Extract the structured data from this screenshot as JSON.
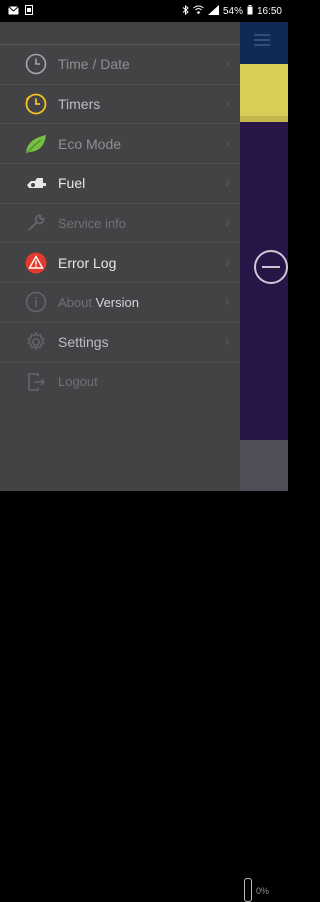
{
  "status_bar": {
    "left_icons": [
      "mail-icon",
      "sim-icon"
    ],
    "right_icons": [
      "bluetooth-icon",
      "wifi-icon",
      "signal-icon"
    ],
    "battery": "54%",
    "time": "16:50"
  },
  "background": {
    "gauge_pct": "0%"
  },
  "menu": [
    {
      "label": "Time / Date",
      "icon": "clock-icon",
      "has_chevron": true
    },
    {
      "label": "Timers",
      "icon": "timer-icon",
      "has_chevron": true
    },
    {
      "label": "Eco Mode",
      "icon": "leaf-icon",
      "has_chevron": true
    },
    {
      "label": "Fuel",
      "icon": "fuel-icon",
      "has_chevron": true
    },
    {
      "label": "Service info",
      "icon": "wrench-icon",
      "has_chevron": true
    },
    {
      "label": "Error Log",
      "icon": "warning-icon",
      "has_chevron": true
    },
    {
      "label_part1": "About",
      "label_part2": "Version",
      "icon": "info-icon",
      "has_chevron": true
    },
    {
      "label": "Settings",
      "icon": "gear-icon",
      "has_chevron": true
    },
    {
      "label": "Logout",
      "icon": "logout-icon",
      "has_chevron": false
    }
  ],
  "colors": {
    "accent_timer": "#f3c421",
    "accent_eco": "#77c043",
    "accent_warning": "#e23b2c",
    "drawer_bg": "#434244"
  }
}
